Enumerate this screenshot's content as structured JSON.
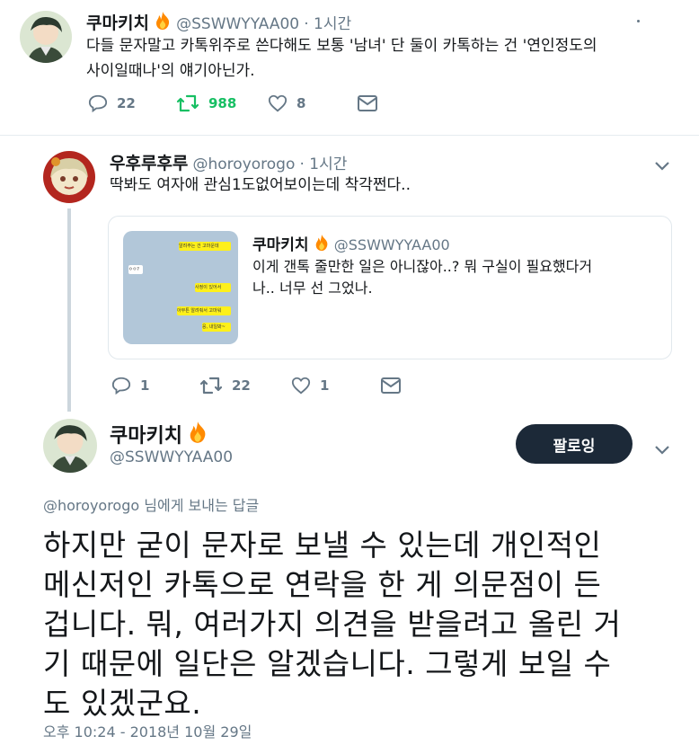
{
  "tweet1": {
    "name": "쿠마키치",
    "handle": "@SSWWYYAA00",
    "time": "· 1시간",
    "text_line1": "다들 문자말고 카톡위주로 쓴다해도 보통 '남녀' 단 둘이 카톡하는 건 '연인정도의",
    "text_line2": "사이일때나'의 얘기아닌가.",
    "reply_count": "22",
    "retweet_count": "988",
    "like_count": "8"
  },
  "tweet2": {
    "name": "우후루후루",
    "handle": "@horoyorogo",
    "time": "· 1시간",
    "text": "딱봐도 여자애 관심1도없어보이는데 착각쩐다..",
    "reply_count": "1",
    "retweet_count": "22",
    "like_count": "1",
    "quote": {
      "name": "쿠마키치",
      "handle": "@SSWWYYAA00",
      "text_line1": "이게 갠톡 줄만한 일은 아니잖아..? 뭐 구실이 필요했다거",
      "text_line2": "나.. 너무 선 그었나.",
      "chat_bubbles": [
        "알려주는 건 고마운데",
        "ㅇㅇ?",
        "사정이 있어서",
        "아무튼 알려줘서 고마워",
        "응, 내일봐~"
      ]
    }
  },
  "tweet3": {
    "name": "쿠마키치",
    "handle": "@SSWWYYAA00",
    "follow_label": "팔로잉",
    "reply_to_handle": "@horoyorogo",
    "reply_to_suffix": " 님에게 보내는 답글",
    "lines": [
      "하지만 굳이 문자로 보낼 수 있는데 개인적인",
      "메신저인 카톡으로 연락을 한 게 의문점이 든",
      "겁니다. 뭐, 여러가지 의견을 받을려고 올린 거",
      "기 때문에 일단은 알겠습니다. 그렇게 보일 수",
      "도 있겠군요."
    ],
    "timestamp": "오후 10:24 - 2018년 10월 29일"
  },
  "colors": {
    "retweet_green": "#17bf63",
    "thread_line": "#ccd6dd",
    "follow_bg": "#1c2938",
    "fire": "#ff8a00"
  }
}
